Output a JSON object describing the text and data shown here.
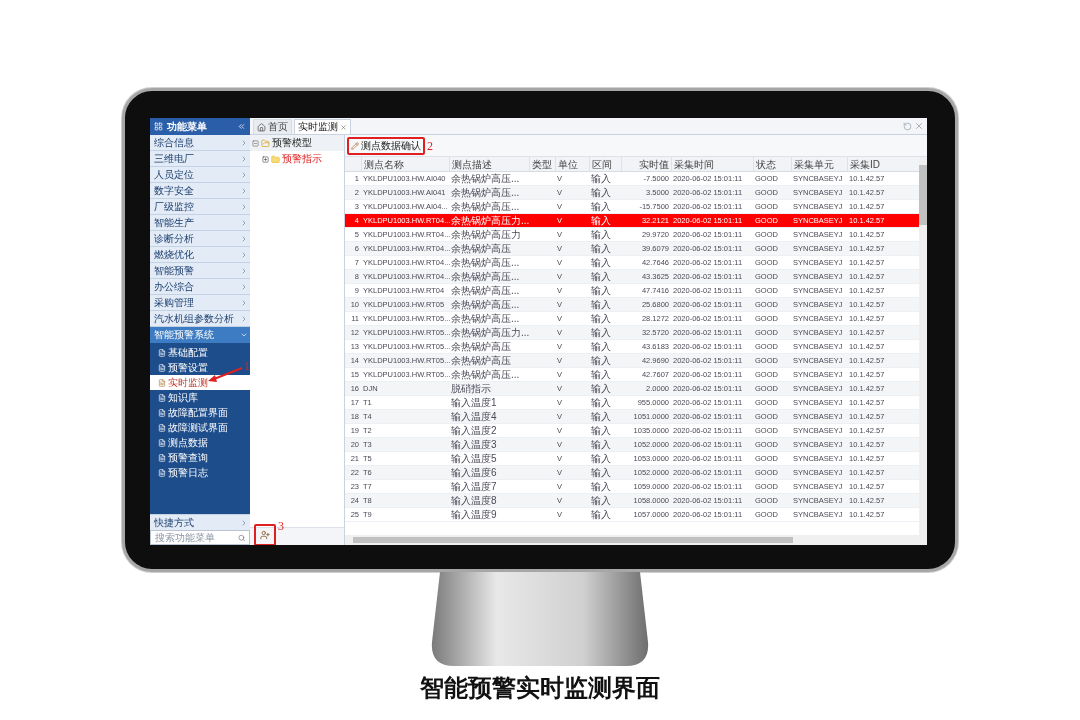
{
  "sidebar": {
    "title": "功能菜单",
    "items": [
      {
        "label": "综合信息"
      },
      {
        "label": "三维电厂"
      },
      {
        "label": "人员定位"
      },
      {
        "label": "数字安全"
      },
      {
        "label": "厂级监控"
      },
      {
        "label": "智能生产"
      },
      {
        "label": "诊断分析"
      },
      {
        "label": "燃烧优化"
      },
      {
        "label": "智能预警"
      },
      {
        "label": "办公综合"
      },
      {
        "label": "采购管理"
      },
      {
        "label": "汽水机组参数分析"
      }
    ],
    "group": {
      "label": "智能预警系统",
      "expanded": true,
      "children": [
        {
          "label": "基础配置",
          "selected": false
        },
        {
          "label": "预警设置",
          "selected": false
        },
        {
          "label": "实时监测",
          "selected": true
        },
        {
          "label": "知识库",
          "selected": false
        },
        {
          "label": "故障配置界面",
          "selected": false
        },
        {
          "label": "故障测试界面",
          "selected": false
        },
        {
          "label": "测点数据",
          "selected": false
        },
        {
          "label": "预警查询",
          "selected": false
        },
        {
          "label": "预警日志",
          "selected": false
        }
      ]
    },
    "shortcut": "快捷方式",
    "search": {
      "placeholder": "搜索功能菜单"
    }
  },
  "tabs": [
    {
      "label": "首页",
      "selected": false
    },
    {
      "label": "实时监测",
      "selected": true
    }
  ],
  "tree": {
    "label": "预警模型",
    "expanded": true,
    "children": [
      {
        "label": "预警指示",
        "expanded": false
      }
    ]
  },
  "toolbar": {
    "button": "测点数据确认"
  },
  "table": {
    "columns": [
      "",
      "测点名称",
      "测点描述",
      "类型",
      "单位",
      "区间",
      "实时值",
      "采集时间",
      "状态",
      "采集单元",
      "采集ID"
    ],
    "rows": [
      {
        "alarm": false,
        "cells": [
          "1",
          "YKLDPU1003.HW.AI040",
          "余热锅炉高压...",
          "",
          "V",
          "输入",
          "-7.5000",
          "2020-06-02 15:01:11",
          "GOOD",
          "SYNCBASEYJ",
          "10.1.42.57"
        ]
      },
      {
        "alarm": false,
        "cells": [
          "2",
          "YKLDPU1003.HW.AI041",
          "余热锅炉高压...",
          "",
          "V",
          "输入",
          "3.5000",
          "2020-06-02 15:01:11",
          "GOOD",
          "SYNCBASEYJ",
          "10.1.42.57"
        ]
      },
      {
        "alarm": false,
        "cells": [
          "3",
          "YKLDPU1003.HW.AI04...",
          "余热锅炉高压...",
          "",
          "V",
          "输入",
          "-15.7500",
          "2020-06-02 15:01:11",
          "GOOD",
          "SYNCBASEYJ",
          "10.1.42.57"
        ]
      },
      {
        "alarm": true,
        "cells": [
          "4",
          "YKLDPU1003.HW.RT04...",
          "余热锅炉高压力...",
          "",
          "V",
          "输入",
          "32.2121",
          "2020-06-02 15:01:11",
          "GOOD",
          "SYNCBASEYJ",
          "10.1.42.57"
        ]
      },
      {
        "alarm": false,
        "cells": [
          "5",
          "YKLDPU1003.HW.RT04...",
          "余热锅炉高压力",
          "",
          "V",
          "输入",
          "29.9720",
          "2020-06-02 15:01:11",
          "GOOD",
          "SYNCBASEYJ",
          "10.1.42.57"
        ]
      },
      {
        "alarm": false,
        "cells": [
          "6",
          "YKLDPU1003.HW.RT04...",
          "余热锅炉高压",
          "",
          "V",
          "输入",
          "39.6079",
          "2020-06-02 15:01:11",
          "GOOD",
          "SYNCBASEYJ",
          "10.1.42.57"
        ]
      },
      {
        "alarm": false,
        "cells": [
          "7",
          "YKLDPU1003.HW.RT04...",
          "余热锅炉高压...",
          "",
          "V",
          "输入",
          "42.7646",
          "2020-06-02 15:01:11",
          "GOOD",
          "SYNCBASEYJ",
          "10.1.42.57"
        ]
      },
      {
        "alarm": false,
        "cells": [
          "8",
          "YKLDPU1003.HW.RT04...",
          "余热锅炉高压...",
          "",
          "V",
          "输入",
          "43.3625",
          "2020-06-02 15:01:11",
          "GOOD",
          "SYNCBASEYJ",
          "10.1.42.57"
        ]
      },
      {
        "alarm": false,
        "cells": [
          "9",
          "YKLDPU1003.HW.RT04",
          "余热锅炉高压...",
          "",
          "V",
          "输入",
          "47.7416",
          "2020-06-02 15:01:11",
          "GOOD",
          "SYNCBASEYJ",
          "10.1.42.57"
        ]
      },
      {
        "alarm": false,
        "cells": [
          "10",
          "YKLDPU1003.HW.RT05",
          "余热锅炉高压...",
          "",
          "V",
          "输入",
          "25.6800",
          "2020-06-02 15:01:11",
          "GOOD",
          "SYNCBASEYJ",
          "10.1.42.57"
        ]
      },
      {
        "alarm": false,
        "cells": [
          "11",
          "YKLDPU1003.HW.RT05...",
          "余热锅炉高压...",
          "",
          "V",
          "输入",
          "28.1272",
          "2020-06-02 15:01:11",
          "GOOD",
          "SYNCBASEYJ",
          "10.1.42.57"
        ]
      },
      {
        "alarm": false,
        "cells": [
          "12",
          "YKLDPU1003.HW.RT05...",
          "余热锅炉高压力...",
          "",
          "V",
          "输入",
          "32.5720",
          "2020-06-02 15:01:11",
          "GOOD",
          "SYNCBASEYJ",
          "10.1.42.57"
        ]
      },
      {
        "alarm": false,
        "cells": [
          "13",
          "YKLDPU1003.HW.RT05...",
          "余热锅炉高压",
          "",
          "V",
          "输入",
          "43.6183",
          "2020-06-02 15:01:11",
          "GOOD",
          "SYNCBASEYJ",
          "10.1.42.57"
        ]
      },
      {
        "alarm": false,
        "cells": [
          "14",
          "YKLDPU1003.HW.RT05...",
          "余热锅炉高压",
          "",
          "V",
          "输入",
          "42.9690",
          "2020-06-02 15:01:11",
          "GOOD",
          "SYNCBASEYJ",
          "10.1.42.57"
        ]
      },
      {
        "alarm": false,
        "cells": [
          "15",
          "YKLDPU1003.HW.RT05...",
          "余热锅炉高压...",
          "",
          "V",
          "输入",
          "42.7607",
          "2020-06-02 15:01:11",
          "GOOD",
          "SYNCBASEYJ",
          "10.1.42.57"
        ]
      },
      {
        "alarm": false,
        "cells": [
          "16",
          "DJN",
          "脱硝指示",
          "",
          "V",
          "输入",
          "2.0000",
          "2020-06-02 15:01:11",
          "GOOD",
          "SYNCBASEYJ",
          "10.1.42.57"
        ]
      },
      {
        "alarm": false,
        "cells": [
          "17",
          "T1",
          "输入温度1",
          "",
          "V",
          "输入",
          "955.0000",
          "2020-06-02 15:01:11",
          "GOOD",
          "SYNCBASEYJ",
          "10.1.42.57"
        ]
      },
      {
        "alarm": false,
        "cells": [
          "18",
          "T4",
          "输入温度4",
          "",
          "V",
          "输入",
          "1051.0000",
          "2020-06-02 15:01:11",
          "GOOD",
          "SYNCBASEYJ",
          "10.1.42.57"
        ]
      },
      {
        "alarm": false,
        "cells": [
          "19",
          "T2",
          "输入温度2",
          "",
          "V",
          "输入",
          "1035.0000",
          "2020-06-02 15:01:11",
          "GOOD",
          "SYNCBASEYJ",
          "10.1.42.57"
        ]
      },
      {
        "alarm": false,
        "cells": [
          "20",
          "T3",
          "输入温度3",
          "",
          "V",
          "输入",
          "1052.0000",
          "2020-06-02 15:01:11",
          "GOOD",
          "SYNCBASEYJ",
          "10.1.42.57"
        ]
      },
      {
        "alarm": false,
        "cells": [
          "21",
          "T5",
          "输入温度5",
          "",
          "V",
          "输入",
          "1053.0000",
          "2020-06-02 15:01:11",
          "GOOD",
          "SYNCBASEYJ",
          "10.1.42.57"
        ]
      },
      {
        "alarm": false,
        "cells": [
          "22",
          "T6",
          "输入温度6",
          "",
          "V",
          "输入",
          "1052.0000",
          "2020-06-02 15:01:11",
          "GOOD",
          "SYNCBASEYJ",
          "10.1.42.57"
        ]
      },
      {
        "alarm": false,
        "cells": [
          "23",
          "T7",
          "输入温度7",
          "",
          "V",
          "输入",
          "1059.0000",
          "2020-06-02 15:01:11",
          "GOOD",
          "SYNCBASEYJ",
          "10.1.42.57"
        ]
      },
      {
        "alarm": false,
        "cells": [
          "24",
          "T8",
          "输入温度8",
          "",
          "V",
          "输入",
          "1058.0000",
          "2020-06-02 15:01:11",
          "GOOD",
          "SYNCBASEYJ",
          "10.1.42.57"
        ]
      },
      {
        "alarm": false,
        "cells": [
          "25",
          "T9",
          "输入温度9",
          "",
          "V",
          "输入",
          "1057.0000",
          "2020-06-02 15:01:11",
          "GOOD",
          "SYNCBASEYJ",
          "10.1.42.57"
        ]
      }
    ]
  },
  "annotations": [
    "1",
    "2",
    "3"
  ],
  "caption": "智能预警实时监测界面"
}
